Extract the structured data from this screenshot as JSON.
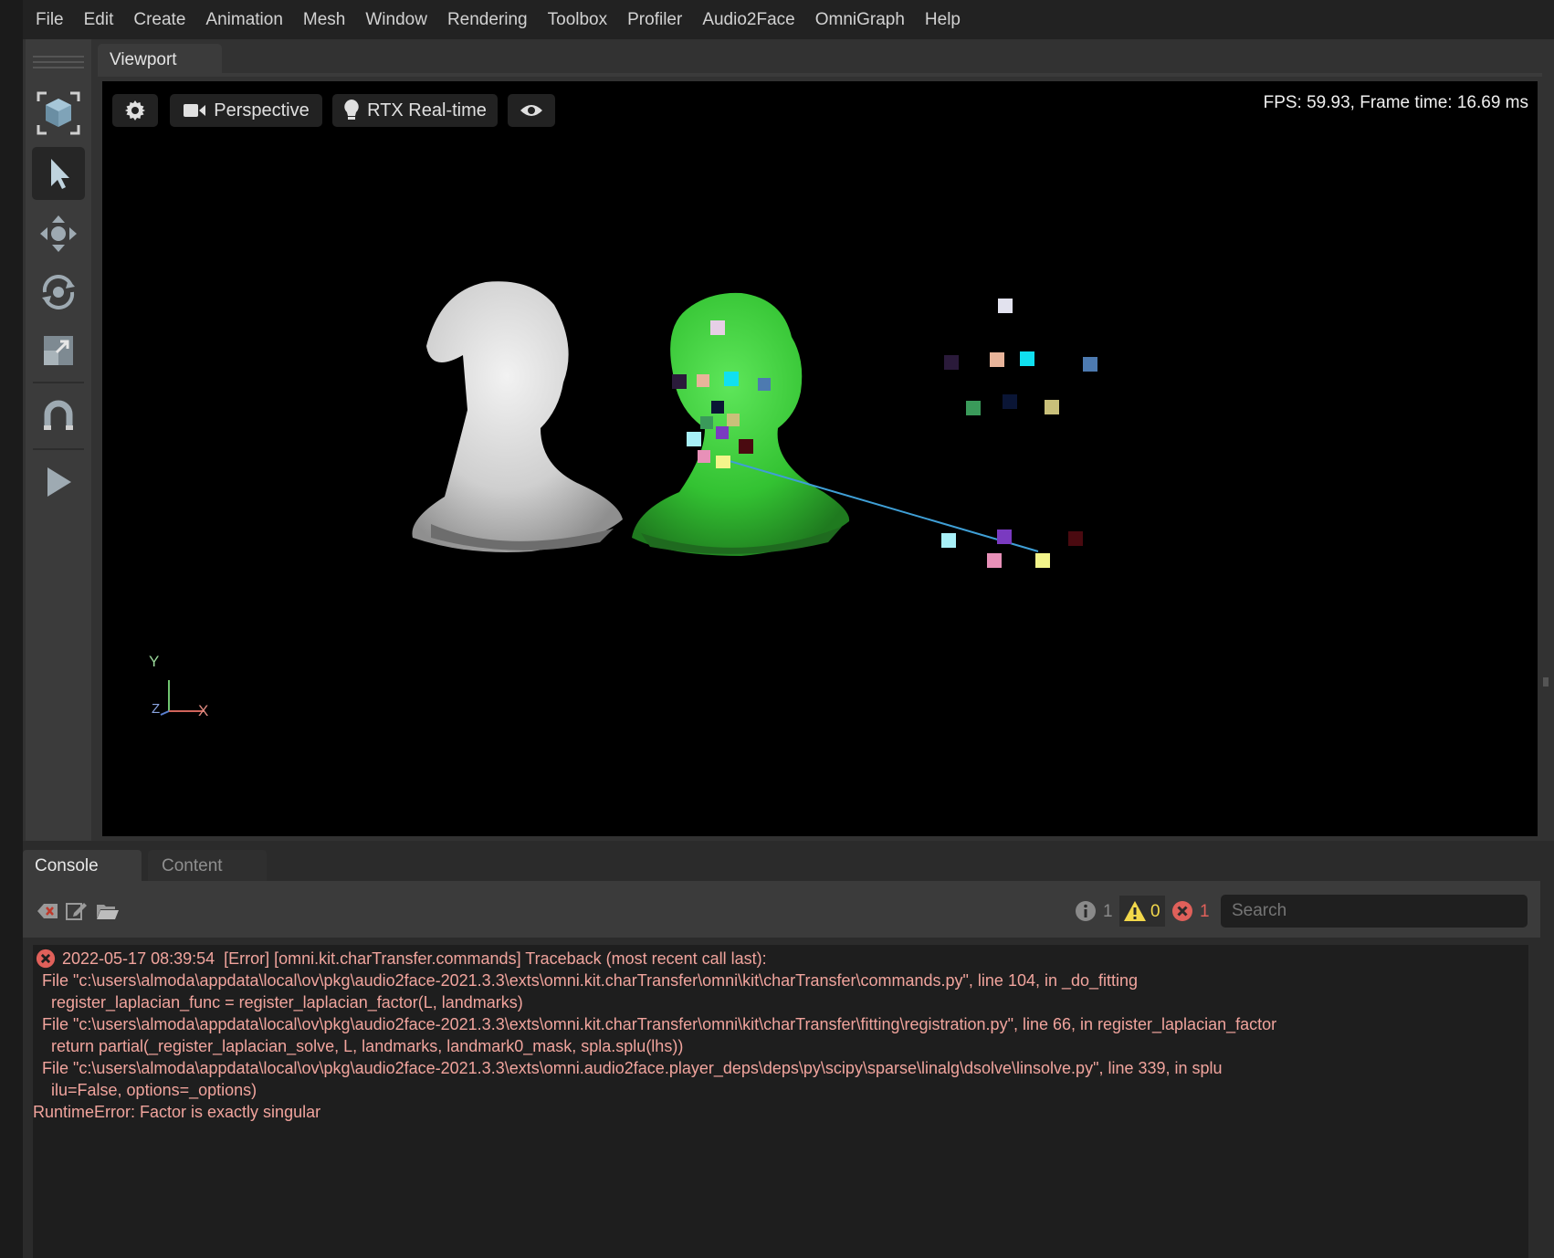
{
  "menu": [
    "File",
    "Edit",
    "Create",
    "Animation",
    "Mesh",
    "Window",
    "Rendering",
    "Toolbox",
    "Profiler",
    "Audio2Face",
    "OmniGraph",
    "Help"
  ],
  "viewport": {
    "tab_label": "Viewport",
    "camera_label": "Perspective",
    "render_label": "RTX Real-time",
    "fps_text": "FPS: 59.93, Frame time: 16.69 ms",
    "axis": {
      "y": "Y",
      "x": "X",
      "z": "Z"
    }
  },
  "tools": [
    "frame-icon",
    "select-icon",
    "move-icon",
    "rotate-icon",
    "scale-icon",
    "snap-icon",
    "play-icon"
  ],
  "console": {
    "tabs": {
      "console": "Console",
      "content": "Content"
    },
    "counts": {
      "info": "1",
      "warning": "0",
      "error": "1"
    },
    "search_placeholder": "Search",
    "lines": [
      "2022-05-17 08:39:54  [Error] [omni.kit.charTransfer.commands] Traceback (most recent call last):",
      "  File \"c:\\users\\almoda\\appdata\\local\\ov\\pkg\\audio2face-2021.3.3\\exts\\omni.kit.charTransfer\\omni\\kit\\charTransfer\\commands.py\", line 104, in _do_fitting",
      "    register_laplacian_func = register_laplacian_factor(L, landmarks)",
      "  File \"c:\\users\\almoda\\appdata\\local\\ov\\pkg\\audio2face-2021.3.3\\exts\\omni.kit.charTransfer\\omni\\kit\\charTransfer\\fitting\\registration.py\", line 66, in register_laplacian_factor",
      "    return partial(_register_laplacian_solve, L, landmarks, landmark0_mask, spla.splu(lhs))",
      "  File \"c:\\users\\almoda\\appdata\\local\\ov\\pkg\\audio2face-2021.3.3\\exts\\omni.audio2face.player_deps\\deps\\py\\scipy\\sparse\\linalg\\dsolve\\linsolve.py\", line 339, in splu",
      "    ilu=False, options=_options)",
      "RuntimeError: Factor is exactly singular"
    ]
  }
}
